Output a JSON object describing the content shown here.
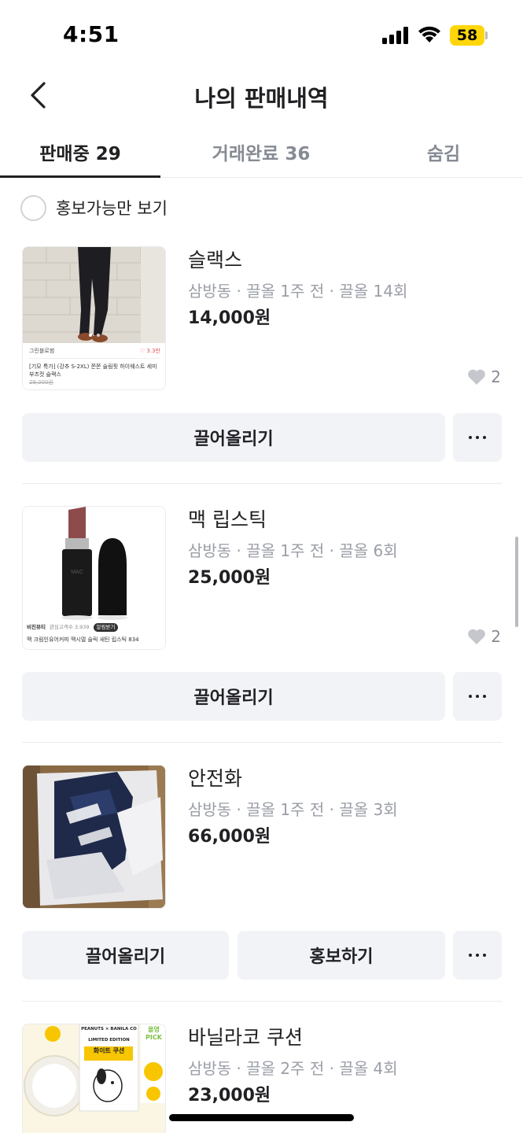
{
  "status_bar": {
    "time": "4:51",
    "battery": "58"
  },
  "header": {
    "title": "나의 판매내역"
  },
  "tabs": [
    {
      "label": "판매중 29",
      "active": true
    },
    {
      "label": "거래완료 36",
      "active": false
    },
    {
      "label": "숨김",
      "active": false
    }
  ],
  "filter": {
    "label": "홍보가능만 보기",
    "checked": false
  },
  "items": [
    {
      "title": "슬랙스",
      "meta": "삼방동 · 끌올 1주 전 · 끌올 14회",
      "price": "14,000원",
      "likes": "2",
      "bump_label": "끌어올리기",
      "thumb_caption_shop": "그린블로썸",
      "thumb_caption_likes": "3.3만",
      "thumb_caption_title": "[기모 특가] (강추 S-2XL) 쫀쫀 슬림핏 하이웨스트 세미 부츠컷 슬랙스",
      "thumb_caption_price": "29,000원"
    },
    {
      "title": "맥 립스틱",
      "meta": "삼방동 · 끌올 1주 전 · 끌올 6회",
      "price": "25,000원",
      "likes": "2",
      "bump_label": "끌어올리기",
      "thumb_caption_shop": "비진뷰티",
      "thumb_caption_sub": "관심고객수 3,939",
      "thumb_caption_badge": "알림받기",
      "thumb_caption_title": "맥 크림인유어커피 맥시멀 슬릭 새틴 립스틱 834",
      "lipstick_brand": "MAC"
    },
    {
      "title": "안전화",
      "meta": "삼방동 · 끌올 1주 전 · 끌올 3회",
      "price": "66,000원",
      "bump_label": "끌어올리기",
      "promote_label": "홍보하기"
    },
    {
      "title": "바닐라코 쿠션",
      "meta": "삼방동 · 끌올 2주 전 · 끌올 4회",
      "price": "23,000원",
      "thumb_caption_pick": "올영 PICK",
      "thumb_caption_edition": "LIMITED EDITION",
      "thumb_caption_product": "화이트 쿠션",
      "thumb_caption_brand": "PEANUTS × BANILA CO"
    }
  ],
  "more_label": "···",
  "colors": {
    "accent_yellow": "#ffd60a",
    "text": "#212124",
    "muted": "#868b94",
    "button_bg": "#f2f3f6"
  }
}
